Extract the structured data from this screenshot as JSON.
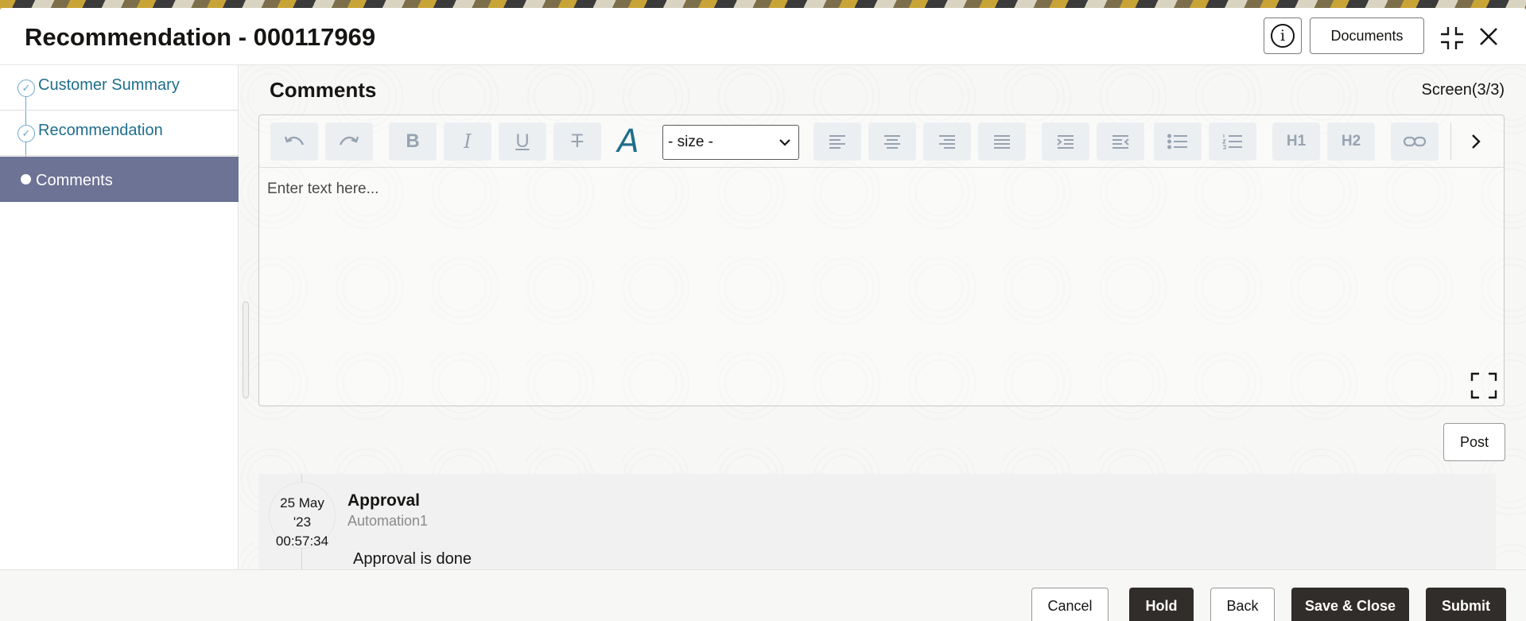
{
  "window": {
    "title": "Recommendation - 000117969",
    "documents_label": "Documents",
    "info_icon_glyph": "i"
  },
  "sidebar": {
    "items": [
      {
        "label": "Customer Summary",
        "state": "completed"
      },
      {
        "label": "Recommendation",
        "state": "completed"
      },
      {
        "label": "Comments",
        "state": "active"
      }
    ]
  },
  "main": {
    "section_title": "Comments",
    "screen_count": "Screen(3/3)",
    "editor": {
      "size_select_value": "- size -",
      "placeholder": "Enter text here...",
      "toolbar_icons": [
        "undo-icon",
        "redo-icon",
        "bold-icon",
        "italic-icon",
        "underline-icon",
        "strikethrough-icon",
        "font-color-icon",
        "align-left-icon",
        "align-center-icon",
        "align-right-icon",
        "justify-icon",
        "indent-icon",
        "outdent-icon",
        "bullet-list-icon",
        "numbered-list-icon",
        "h1-icon",
        "h2-icon",
        "link-icon",
        "chevron-right-icon"
      ],
      "h1_label": "H1",
      "h2_label": "H2"
    },
    "post_label": "Post",
    "comments": [
      {
        "date_line1": "25 May",
        "date_line2": "'23",
        "time": "00:57:34",
        "title": "Approval",
        "user": "Automation1",
        "text": "Approval is done"
      }
    ]
  },
  "footer": {
    "cancel_label": "Cancel",
    "hold_label": "Hold",
    "back_label": "Back",
    "save_close_label": "Save & Close",
    "submit_label": "Submit"
  },
  "colors": {
    "active_nav": "#6c7395",
    "link_teal": "#1f6e8c",
    "dark_button": "#312d2a"
  }
}
